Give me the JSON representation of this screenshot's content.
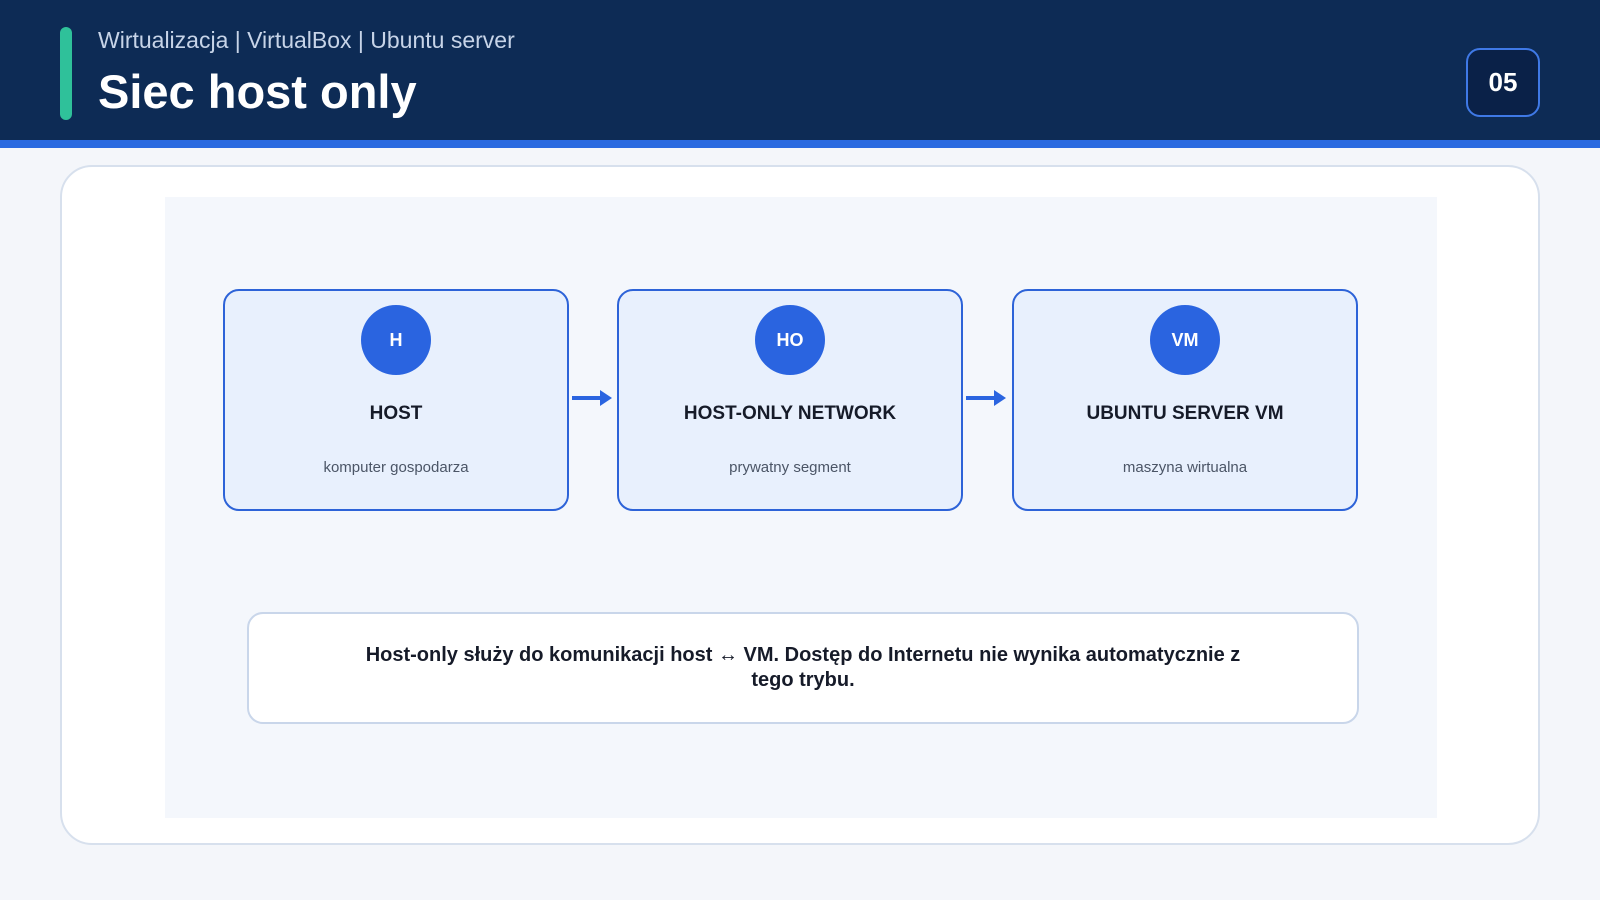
{
  "header": {
    "subtitle": "Wirtualizacja | VirtualBox | Ubuntu server",
    "title": "Siec host only",
    "page_number": "05"
  },
  "diagram": {
    "nodes": [
      {
        "abbr": "H",
        "title": "HOST",
        "description": "komputer gospodarza"
      },
      {
        "abbr": "HO",
        "title": "HOST-ONLY NETWORK",
        "description": "prywatny segment"
      },
      {
        "abbr": "VM",
        "title": "UBUNTU SERVER VM",
        "description": "maszyna wirtualna"
      }
    ],
    "note": "Host-only służy do komunikacji host ↔ VM. Dostęp do Internetu nie wynika automatycznie z tego trybu."
  },
  "colors": {
    "header_bg": "#0d2b55",
    "accent": "#2fc19a",
    "primary_blue": "#2a64e0",
    "node_bg": "#e8f0fd"
  }
}
